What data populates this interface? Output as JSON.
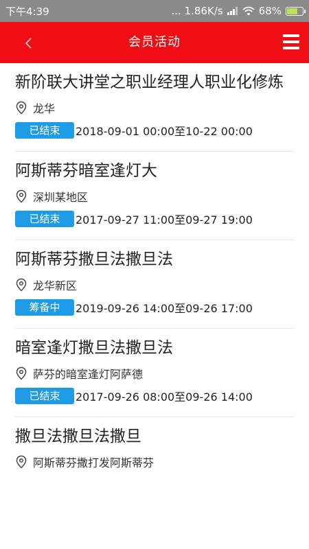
{
  "status_bar": {
    "time": "下午4:39",
    "network_speed": "... 1.86K/s",
    "battery": "68%"
  },
  "header": {
    "title": "会员活动"
  },
  "events": [
    {
      "title": "新阶联大讲堂之职业经理人职业化修炼",
      "location": "龙华",
      "status": "已结束",
      "time_range": "2018-09-01 00:00至10-22 00:00"
    },
    {
      "title": "阿斯蒂芬暗室逢灯大",
      "location": "深圳某地区",
      "status": "已结束",
      "time_range": "2017-09-27 11:00至09-27 19:00"
    },
    {
      "title": "阿斯蒂芬撒旦法撒旦法",
      "location": "龙华新区",
      "status": "筹备中",
      "time_range": "2019-09-26 14:00至09-26 17:00"
    },
    {
      "title": "暗室逢灯撒旦法撒旦法",
      "location": "萨芬的暗室逢灯阿萨德",
      "status": "已结束",
      "time_range": "2017-09-26 08:00至09-26 14:00"
    },
    {
      "title": "撒旦法撒旦法撒旦",
      "location": "阿斯蒂芬撒打发阿斯蒂芬",
      "status": "",
      "time_range": ""
    }
  ]
}
